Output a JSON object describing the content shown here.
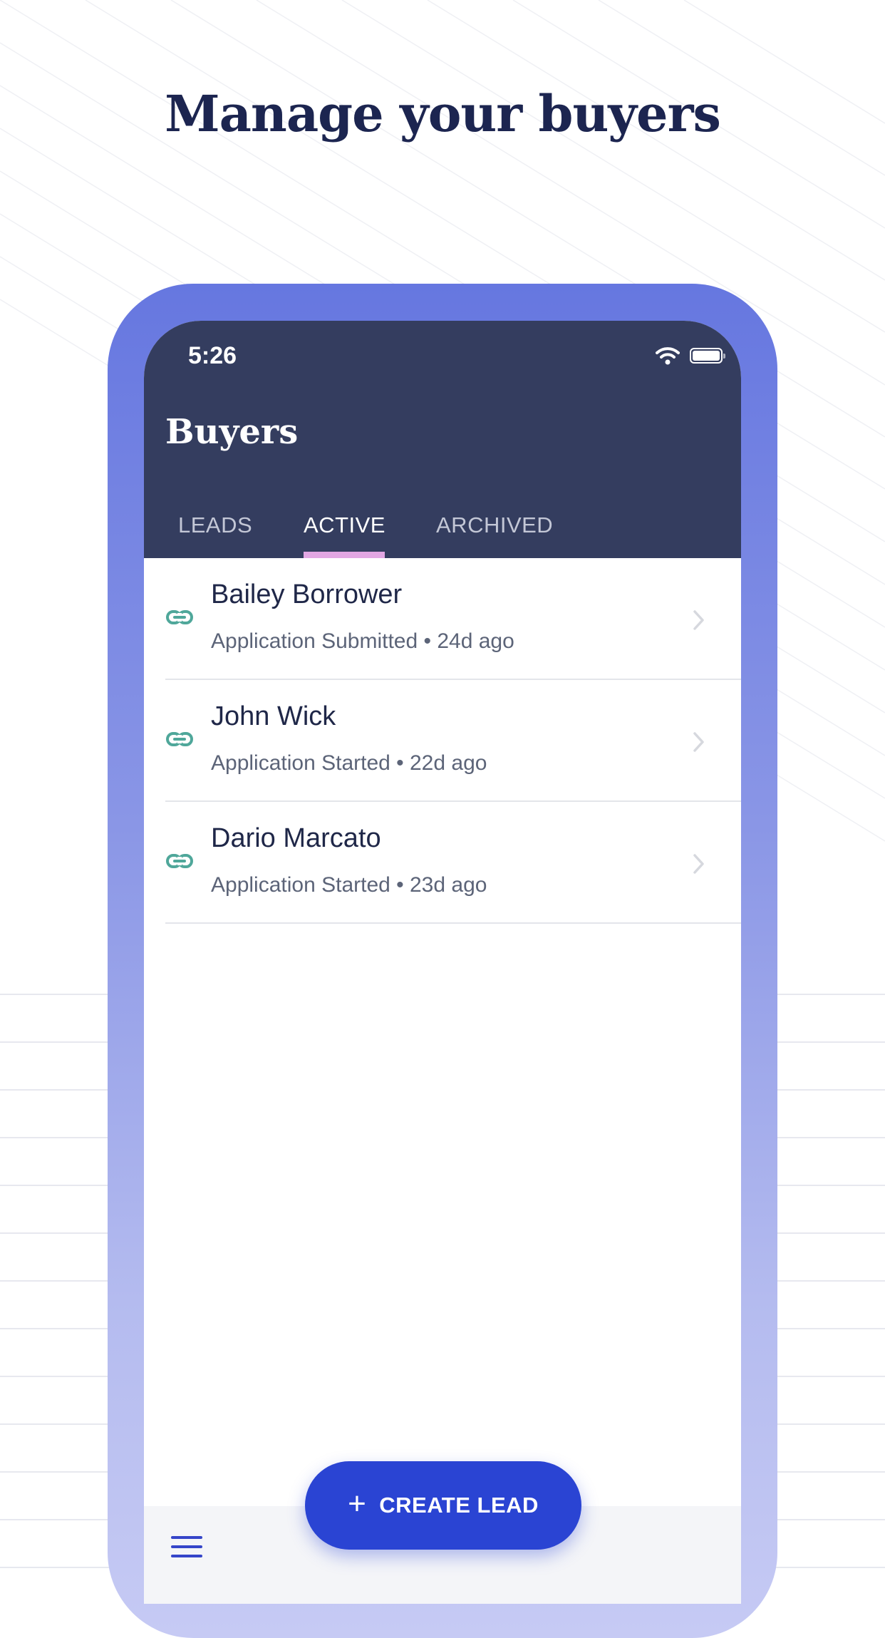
{
  "headline": "Manage your buyers",
  "status_bar": {
    "time": "5:26",
    "wifi_icon": "wifi-icon",
    "battery_icon": "battery-icon"
  },
  "app": {
    "title": "Buyers",
    "tabs": [
      {
        "label": "LEADS",
        "active": false
      },
      {
        "label": "ACTIVE",
        "active": true
      },
      {
        "label": "ARCHIVED",
        "active": false
      }
    ],
    "buyers": [
      {
        "name": "Bailey Borrower",
        "meta": "Application Submitted • 24d ago",
        "icon": "link-icon"
      },
      {
        "name": "John Wick",
        "meta": "Application Started • 22d ago",
        "icon": "link-icon"
      },
      {
        "name": "Dario Marcato",
        "meta": "Application Started • 23d ago",
        "icon": "link-icon"
      }
    ],
    "create_button_label": "CREATE LEAD",
    "menu_icon": "hamburger-menu-icon"
  },
  "colors": {
    "headline": "#1c2550",
    "header_bg": "#343d5f",
    "tab_indicator": "#e2a7e3",
    "link_icon": "#4fa79a",
    "primary_button": "#2a44d3",
    "frame_gradient_top": "#6677e0",
    "frame_gradient_bottom": "#c6caf4"
  }
}
